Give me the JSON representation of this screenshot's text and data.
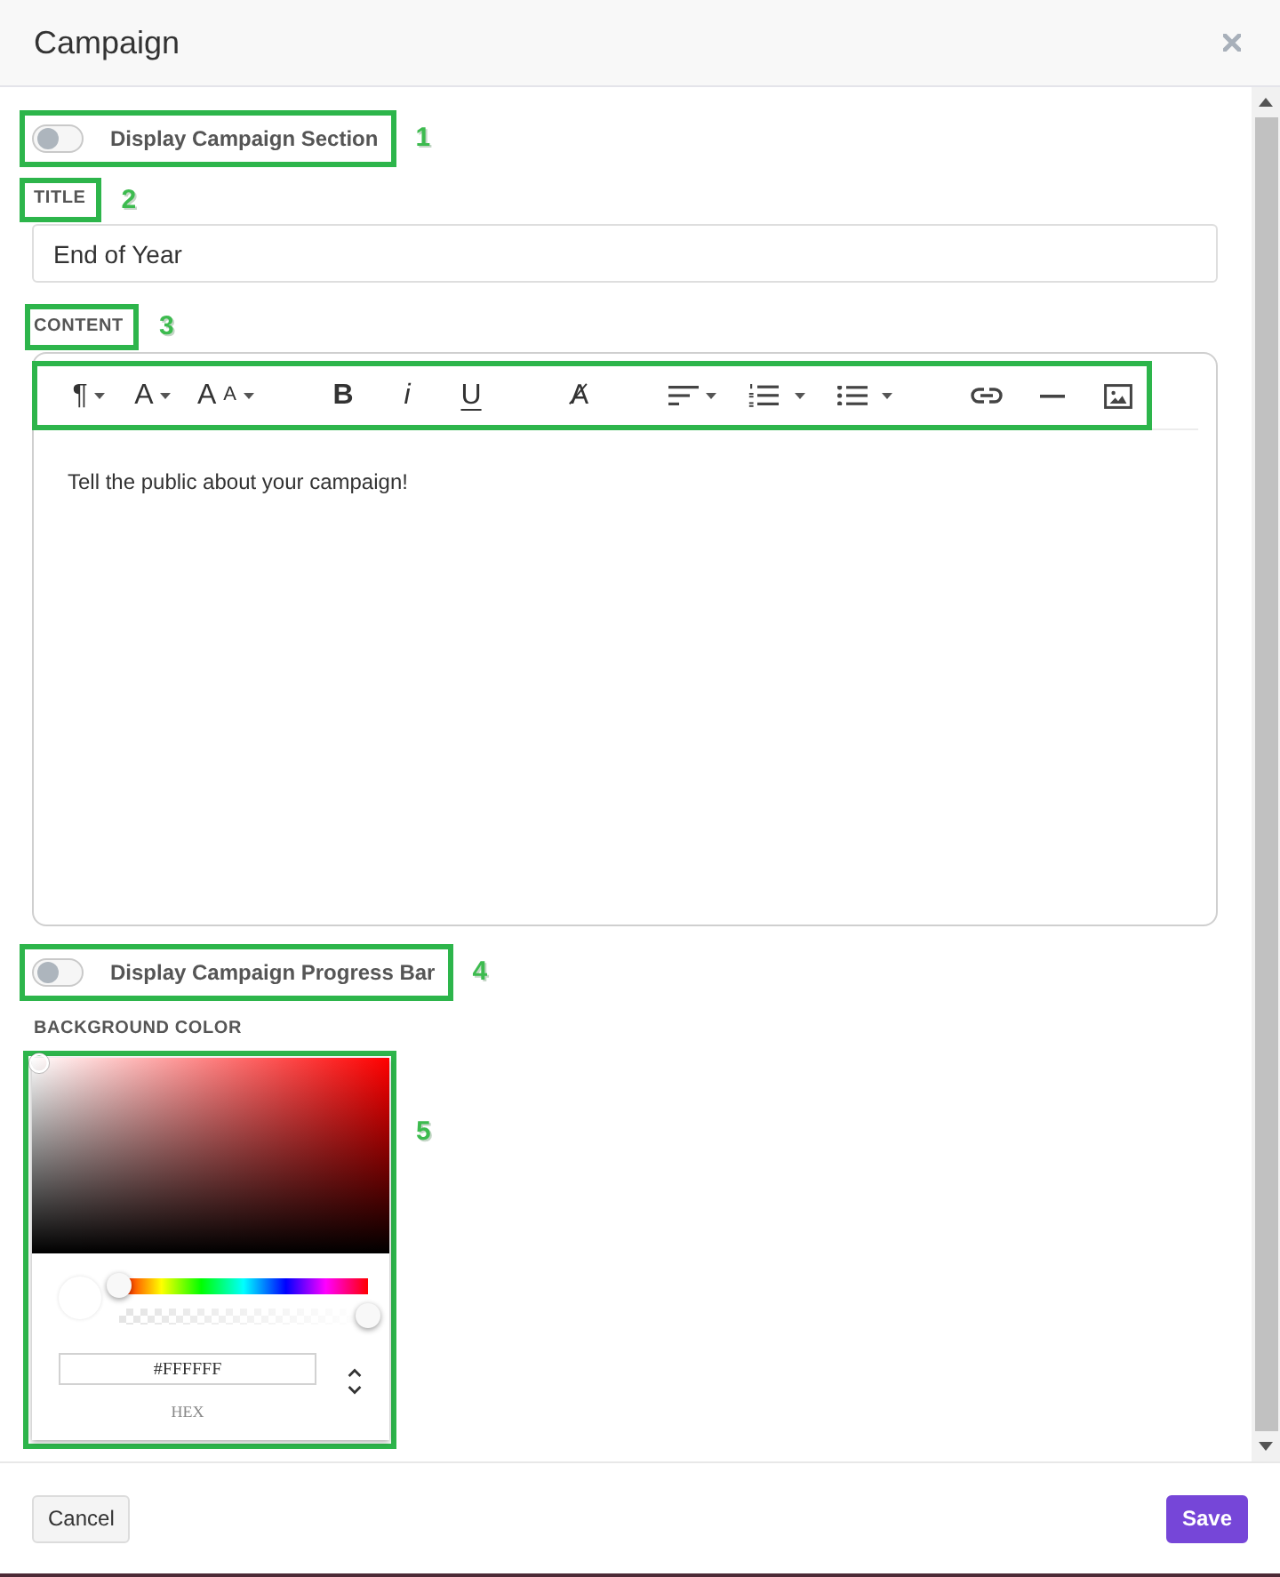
{
  "modal": {
    "title": "Campaign"
  },
  "fields": [
    {
      "kind": "toggle",
      "label": "Display Campaign Section",
      "on": false,
      "callout": "1"
    },
    {
      "kind": "text",
      "label": "TITLE",
      "callout": "2",
      "value": "End of Year"
    },
    {
      "kind": "editor",
      "label": "CONTENT",
      "callout": "3",
      "toolbar_framed": true,
      "toolbar": [
        [
          {
            "kind": "paragraph",
            "glyph": "¶",
            "dropdown": true
          },
          {
            "kind": "font",
            "glyph": "A",
            "dropdown": true
          },
          {
            "kind": "size",
            "glyph": "A",
            "small_glyph": "A",
            "dropdown": true
          }
        ],
        [
          {
            "kind": "bold",
            "glyph": "B",
            "dropdown": false
          },
          {
            "kind": "italic",
            "glyph": "i",
            "dropdown": false
          },
          {
            "kind": "underline",
            "glyph": "U",
            "dropdown": false
          }
        ],
        [
          {
            "kind": "clear",
            "glyph": "A̸",
            "dropdown": false
          }
        ],
        [
          {
            "kind": "align",
            "dropdown": true
          },
          {
            "kind": "numbered",
            "dropdown": true
          },
          {
            "kind": "bulleted",
            "dropdown": true
          }
        ],
        [
          {
            "kind": "link",
            "dropdown": false
          },
          {
            "kind": "rule",
            "dropdown": false
          },
          {
            "kind": "image",
            "dropdown": false
          }
        ]
      ],
      "body": "Tell the public about your campaign!"
    },
    {
      "kind": "toggle",
      "label": "Display Campaign Progress Bar",
      "on": false,
      "callout": "4"
    },
    {
      "kind": "color",
      "label": "BACKGROUND COLOR",
      "callout": "5",
      "hex": "#FFFFFF",
      "format": "HEX",
      "sliders": [
        {
          "kind": "hue",
          "level": 0
        },
        {
          "kind": "alpha",
          "level": 1
        }
      ]
    }
  ],
  "footer": {
    "buttons": [
      {
        "label": "Cancel",
        "kind": "secondary"
      },
      {
        "label": "Save",
        "kind": "primary"
      }
    ]
  }
}
